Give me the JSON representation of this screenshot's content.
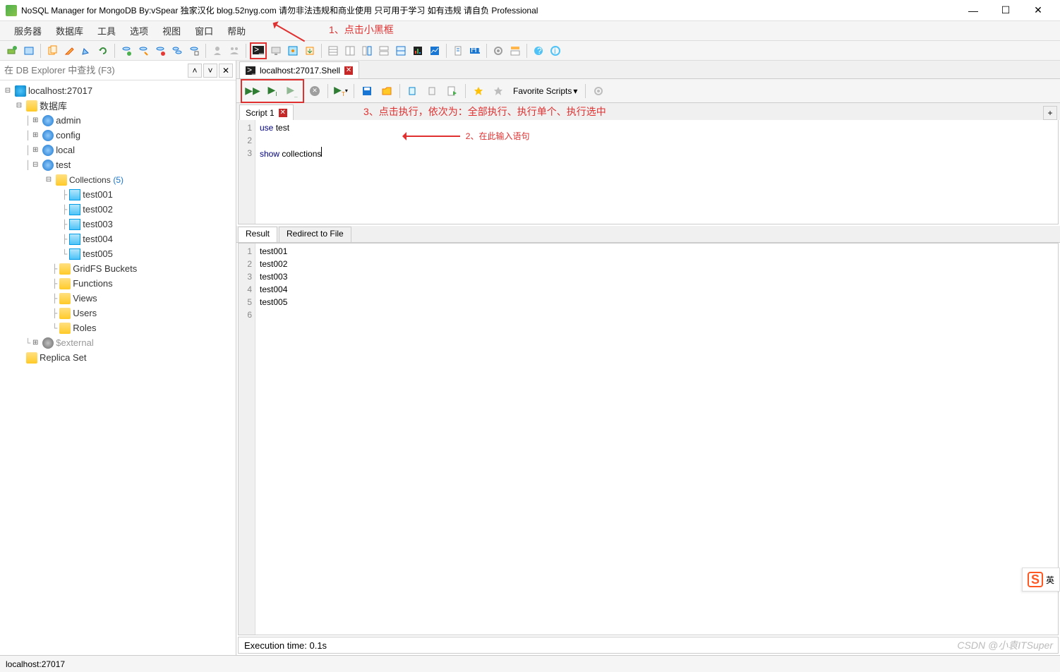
{
  "window": {
    "title": "NoSQL Manager for MongoDB By:vSpear 独家汉化 blog.52nyg.com 请勿非法违规和商业使用 只可用于学习 如有违规 请自负 Professional"
  },
  "menu": [
    "服务器",
    "数据库",
    "工具",
    "选项",
    "视图",
    "窗口",
    "帮助"
  ],
  "annotations": {
    "a1": "1、点击小黑框",
    "a2": "2、在此输入语句",
    "a3": "3、点击执行，依次为：全部执行、执行单个、执行选中"
  },
  "search": {
    "placeholder": "在 DB Explorer 中查找 (F3)"
  },
  "tree": {
    "server": "localhost:27017",
    "db_folder": "数据库",
    "dbs": [
      "admin",
      "config",
      "local"
    ],
    "test_db": "test",
    "collections_label": "Collections",
    "collections_count": "(5)",
    "collections": [
      "test001",
      "test002",
      "test003",
      "test004",
      "test005"
    ],
    "subfolders": [
      "GridFS Buckets",
      "Functions",
      "Views",
      "Users",
      "Roles"
    ],
    "external": "$external",
    "replica": "Replica Set"
  },
  "doc_tab": {
    "label": "localhost:27017.Shell"
  },
  "shell_toolbar": {
    "favorite": "Favorite Scripts"
  },
  "script_tab": {
    "label": "Script 1"
  },
  "editor": {
    "lines": [
      {
        "n": "1",
        "kw": "use",
        "rest": " test"
      },
      {
        "n": "2",
        "kw": "",
        "rest": ""
      },
      {
        "n": "3",
        "kw": "show",
        "rest": " collections"
      }
    ]
  },
  "result_tabs": {
    "result": "Result",
    "redirect": "Redirect to File"
  },
  "result": {
    "rows": [
      "test001",
      "test002",
      "test003",
      "test004",
      "test005",
      ""
    ]
  },
  "exec_status": "Execution time: 0.1s",
  "statusbar": "localhost:27017",
  "watermark": "CSDN @小袁ITSuper",
  "ime": "英"
}
